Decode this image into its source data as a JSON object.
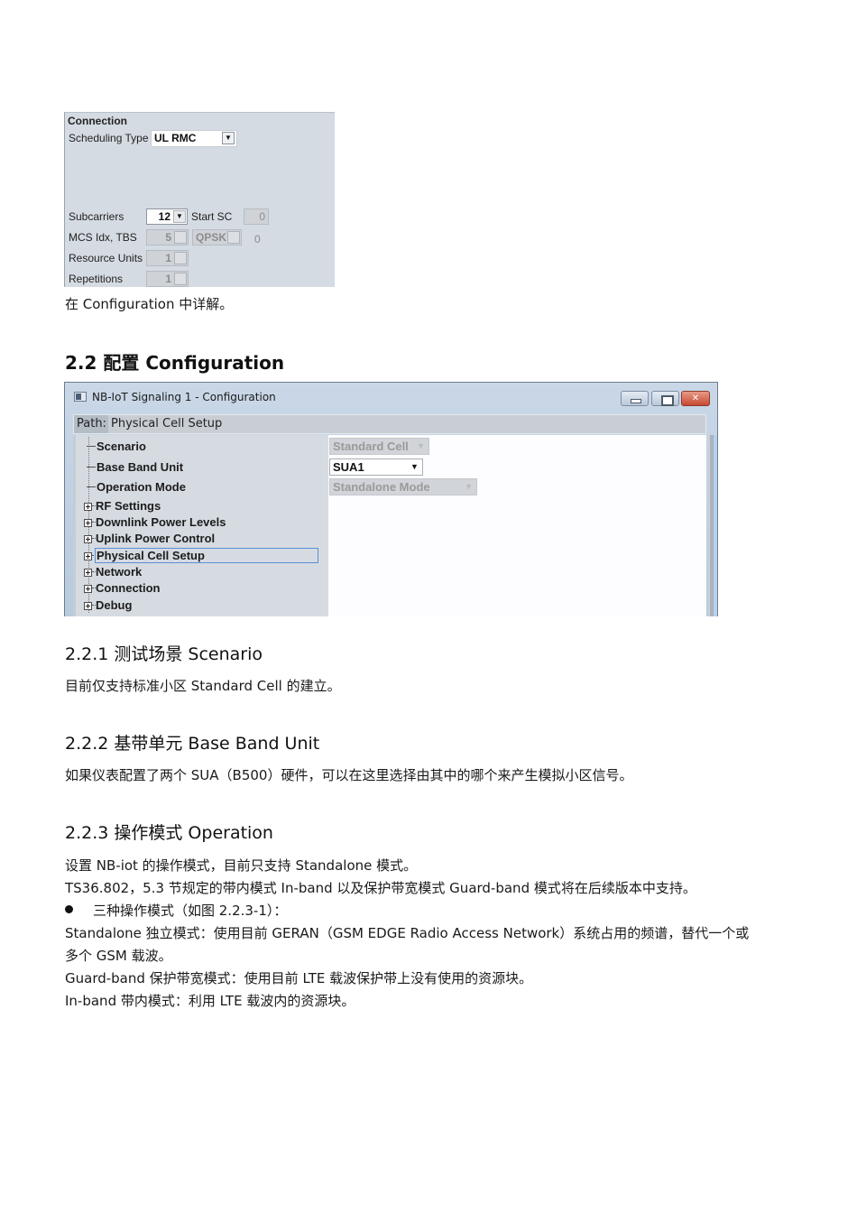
{
  "connection_panel": {
    "title": "Connection",
    "scheduling_type_label": "Scheduling Type",
    "scheduling_type_value": "UL RMC",
    "subcarriers_label": "Subcarriers",
    "subcarriers_value": "12",
    "start_sc_label": "Start SC",
    "start_sc_value": "0",
    "mcs_label": "MCS Idx, TBS",
    "mcs_value": "5",
    "modulation_value": "QPSK",
    "tbs_value": "0",
    "resource_units_label": "Resource Units",
    "resource_units_value": "1",
    "repetitions_label": "Repetitions",
    "repetitions_value": "1"
  },
  "doc": {
    "line_after_panel1": "在 Configuration 中详解。",
    "section_2_2": "2.2 配置 Configuration",
    "section_2_2_1": "2.2.1 测试场景 Scenario",
    "p_2_2_1": "目前仅支持标准小区 Standard Cell 的建立。",
    "section_2_2_2": "2.2.2 基带单元 Base Band Unit",
    "p_2_2_2": "如果仪表配置了两个 SUA（B500）硬件，可以在这里选择由其中的哪个来产生模拟小区信号。",
    "section_2_2_3": "2.2.3 操作模式 Operation",
    "p_2_2_3_a": "设置 NB-iot 的操作模式，目前只支持 Standalone 模式。",
    "p_2_2_3_b": "TS36.802，5.3 节规定的带内模式 In-band 以及保护带宽模式 Guard-band 模式将在后续版本中支持。",
    "bullet_1": "三种操作模式（如图 2.2.3-1）：",
    "p_standalone_1": "Standalone 独立模式：使用目前 GERAN（GSM EDGE Radio Access Network）系统占用的频谱，替代一个或",
    "p_standalone_2": "多个 GSM 载波。",
    "p_guardband": "Guard-band 保护带宽模式：使用目前 LTE 载波保护带上没有使用的资源块。",
    "p_inband": "In-band 带内模式：利用 LTE 载波内的资源块。"
  },
  "config_window": {
    "title": "NB-IoT Signaling 1 - Configuration",
    "minimize_label": "",
    "maximize_label": "",
    "close_label": "✕",
    "path_label": "Path:",
    "path_value": "Physical Cell Setup",
    "tree": [
      {
        "label": "Scenario",
        "expandable": false
      },
      {
        "label": "Base Band Unit",
        "expandable": false
      },
      {
        "label": "Operation Mode",
        "expandable": false
      },
      {
        "label": "RF Settings",
        "expandable": true
      },
      {
        "label": "Downlink Power Levels",
        "expandable": true
      },
      {
        "label": "Uplink Power Control",
        "expandable": true
      },
      {
        "label": "Physical Cell Setup",
        "expandable": true,
        "selected": true
      },
      {
        "label": "Network",
        "expandable": true
      },
      {
        "label": "Connection",
        "expandable": true
      },
      {
        "label": "Debug",
        "expandable": true
      }
    ],
    "scenario_value": "Standard Cell",
    "base_band_unit_value": "SUA1",
    "operation_mode_value": "Standalone Mode",
    "dropdown_arrow": "▼"
  }
}
